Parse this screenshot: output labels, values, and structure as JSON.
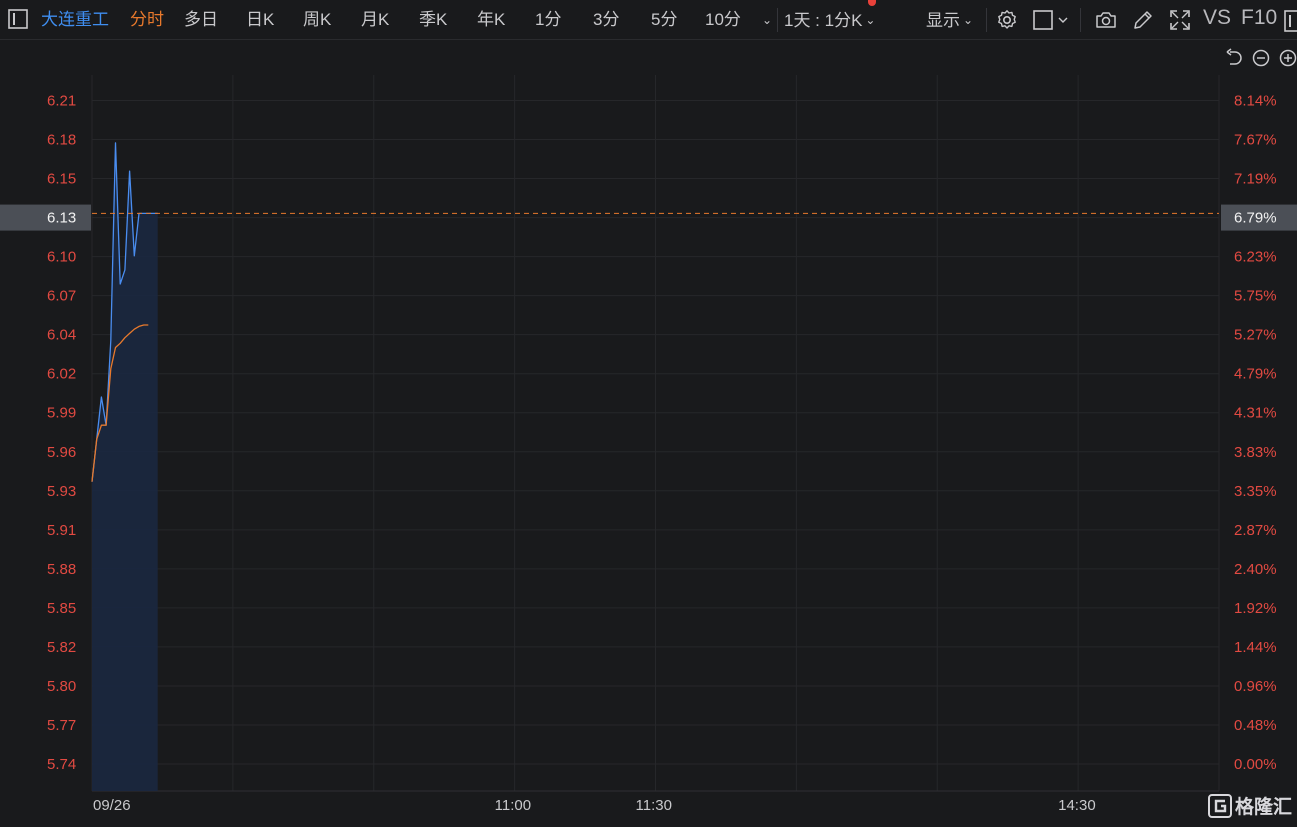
{
  "toolbar": {
    "stock_name": "大连重工",
    "tabs": [
      "分时",
      "多日",
      "日K",
      "周K",
      "月K",
      "季K",
      "年K",
      "1分",
      "3分",
      "5分",
      "10分"
    ],
    "active_tab": "分时",
    "period_selector": "1天 : 1分K",
    "display_label": "显示",
    "vs_label": "VS",
    "f10_label": "F10",
    "colors": {
      "active_name": "#3f8ef0",
      "active_tab": "#e8792c",
      "notification_dot": "#e8413a"
    }
  },
  "icons": [
    "sidebar-toggle-icon",
    "chevron-down-icon",
    "gear-icon",
    "square-icon",
    "camera-icon",
    "pencil-icon",
    "fullscreen-icon",
    "undo-icon",
    "zoom-out-icon",
    "zoom-in-icon"
  ],
  "watermark": "格隆汇",
  "chart_data": {
    "type": "line",
    "title": "",
    "x_labels": [
      "09/26",
      "11:00",
      "11:30",
      "14:30"
    ],
    "y_ticks": [
      "6.21",
      "6.18",
      "6.15",
      "6.13",
      "6.10",
      "6.07",
      "6.04",
      "6.02",
      "5.99",
      "5.96",
      "5.93",
      "5.91",
      "5.88",
      "5.85",
      "5.82",
      "5.80",
      "5.77",
      "5.74"
    ],
    "y_pct_ticks": [
      "8.14%",
      "7.67%",
      "7.19%",
      "6.79%",
      "6.23%",
      "5.75%",
      "5.27%",
      "4.79%",
      "4.31%",
      "3.83%",
      "3.35%",
      "2.87%",
      "2.40%",
      "1.92%",
      "1.44%",
      "0.96%",
      "0.48%",
      "0.00%"
    ],
    "ylim": [
      5.74,
      6.21
    ],
    "minutes_total": 240,
    "current_price": 6.13,
    "current_pct": "6.79%",
    "series": [
      {
        "name": "",
        "color": "#4a8df0",
        "fill": true,
        "minutes": [
          0,
          1,
          2,
          3,
          4,
          5,
          6,
          7,
          8,
          9,
          10,
          11,
          12,
          13,
          14
        ],
        "values": [
          5.94,
          5.97,
          6.0,
          5.98,
          6.04,
          6.18,
          6.08,
          6.09,
          6.16,
          6.1,
          6.13,
          6.13,
          6.13,
          6.13,
          6.13
        ]
      },
      {
        "name": "",
        "color": "#e8792c",
        "fill": false,
        "minutes": [
          0,
          1,
          2,
          3,
          4,
          5,
          6,
          7,
          8,
          9,
          10,
          11,
          12
        ],
        "values": [
          5.94,
          5.97,
          5.98,
          5.98,
          6.02,
          6.035,
          6.038,
          6.042,
          6.045,
          6.048,
          6.05,
          6.051,
          6.051
        ]
      }
    ],
    "grid": true
  }
}
